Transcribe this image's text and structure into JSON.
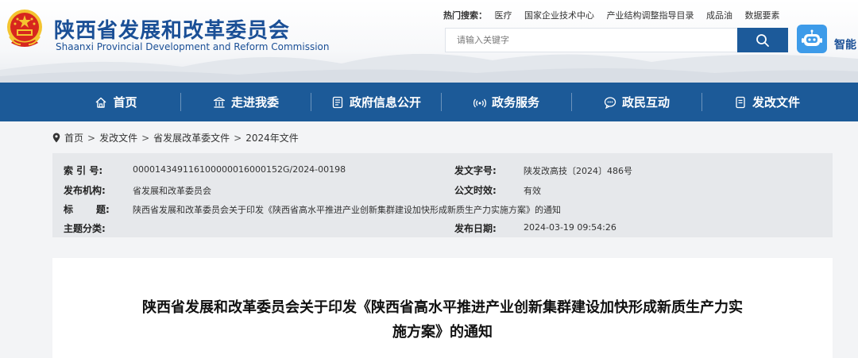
{
  "header": {
    "title_zh": "陕西省发展和改革委员会",
    "title_en": "Shaanxi Provincial Development and Reform Commission",
    "hot_label": "热门搜索：",
    "hot_items": [
      "医疗",
      "国家企业技术中心",
      "产业结构调整指导目录",
      "成品油",
      "数据要素"
    ],
    "search_placeholder": "请输入关键字",
    "search_icon": "search-icon",
    "assistant_icon": "robot-icon",
    "assistant_label": "智能"
  },
  "nav": {
    "items": [
      {
        "label": "首页",
        "icon": "home-icon"
      },
      {
        "label": "走进我委",
        "icon": "building-icon"
      },
      {
        "label": "政府信息公开",
        "icon": "document-icon"
      },
      {
        "label": "政务服务",
        "icon": "signal-icon"
      },
      {
        "label": "政民互动",
        "icon": "chat-icon"
      },
      {
        "label": "发改文件",
        "icon": "file-icon"
      }
    ]
  },
  "breadcrumb": {
    "items": [
      "首页",
      "发改文件",
      "省发展改革委文件",
      "2024年文件"
    ],
    "separator": ">"
  },
  "meta": {
    "index_label": "索 引 号:",
    "index_value": "000014349116100000016000152G/2024-00198",
    "doc_no_label": "发文字号:",
    "doc_no_value": "陕发改高技〔2024〕486号",
    "issuer_label": "发布机构:",
    "issuer_value": "省发展和改革委员会",
    "validity_label": "公文时效:",
    "validity_value": "有效",
    "title_label_1": "标",
    "title_label_2": "题:",
    "title_value": "陕西省发展和改革委员会关于印发《陕西省高水平推进产业创新集群建设加快形成新质生产力实施方案》的通知",
    "topic_label": "主题分类:",
    "topic_value": "",
    "date_label": "发布日期:",
    "date_value": "2024-03-19 09:54:26"
  },
  "content": {
    "title_line1": "陕西省发展和改革委员会关于印发《陕西省高水平推进产业创新集群建设加快形成新质生产力实",
    "title_line2": "施方案》的通知"
  },
  "colors": {
    "brand_blue": "#1c5a98",
    "title_blue": "#1a4f96",
    "emblem_red": "#d7261e",
    "emblem_gold": "#f4c430",
    "robot_blue": "#3d9be9"
  }
}
